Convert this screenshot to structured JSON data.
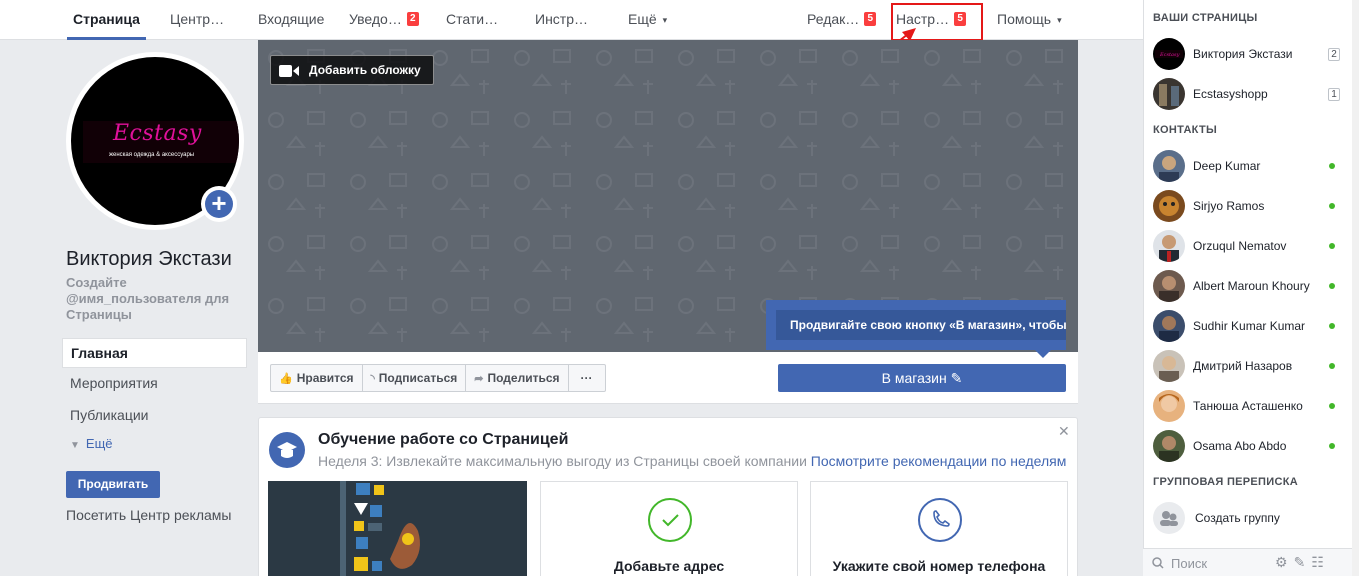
{
  "tabs": [
    {
      "label": "Страница",
      "active": true
    },
    {
      "label": "Центр…"
    },
    {
      "label": "Входящие"
    },
    {
      "label": "Уведо…",
      "badge": "2"
    },
    {
      "label": "Стати…"
    },
    {
      "label": "Инстр…"
    },
    {
      "label": "Ещё",
      "caret": "▾"
    },
    {
      "label": "Редак…",
      "badge": "5"
    },
    {
      "label": "Настр…",
      "badge": "5"
    },
    {
      "label": "Помощь",
      "caret": "▾"
    }
  ],
  "profile": {
    "logo_text": "Ecstasy",
    "logo_subtitle": "женская одежда & аксессуары",
    "page_name": "Виктория Экстази",
    "username_prompt": "Создайте @имя_пользователя для Страницы"
  },
  "left_nav": {
    "items": [
      "Главная",
      "Мероприятия",
      "Публикации"
    ],
    "more": "Ещё",
    "promote_button": "Продвигать",
    "ads_center": "Посетить Центр рекламы"
  },
  "cover": {
    "add_cover_button": "Добавить обложку"
  },
  "actions": {
    "like": "Нравится",
    "follow": "Подписаться",
    "share": "Поделиться",
    "more": "···",
    "shop_button": "В магазин ✎"
  },
  "tooltip": {
    "text": "Продвигайте свою кнопку «В магазин», чтобы получить бо"
  },
  "learning_card": {
    "title": "Обучение работе со Страницей",
    "subtitle": "Неделя 3: Извлекайте максимальную выгоду из Страницы своей компании",
    "link": "Посмотрите рекомендации по неделям",
    "close": "✕",
    "tiles": [
      {
        "label": "Добавьте адрес",
        "icon": "check-icon",
        "color": "#42b72a"
      },
      {
        "label": "Укажите свой номер телефона",
        "icon": "phone-icon",
        "color": "#4267b2"
      }
    ]
  },
  "sidebar": {
    "pages_header": "ВАШИ СТРАНИЦЫ",
    "pages": [
      {
        "name": "Виктория Экстази",
        "count": "2"
      },
      {
        "name": "Ecstasyshopp",
        "count": "1"
      }
    ],
    "contacts_header": "КОНТАКТЫ",
    "contacts": [
      {
        "name": "Deep Kumar",
        "color": "#5a6e8a"
      },
      {
        "name": "Sirjyo Ramos",
        "color": "#7a4a1e"
      },
      {
        "name": "Orzuqul Nematov",
        "color": "#3d4652"
      },
      {
        "name": "Albert Maroun Khoury",
        "color": "#6d5a4e"
      },
      {
        "name": "Sudhir Kumar Kumar",
        "color": "#3b4d6b"
      },
      {
        "name": "Дмитрий Назаров",
        "color": "#a89f94"
      },
      {
        "name": "Танюша Асташенко",
        "color": "#d49060"
      },
      {
        "name": "Osama Abo Abdo",
        "color": "#4e5e3e"
      }
    ],
    "group_header": "ГРУППОВАЯ ПЕРЕПИСКА",
    "create_group": "Создать группу",
    "search_placeholder": "Поиск"
  }
}
